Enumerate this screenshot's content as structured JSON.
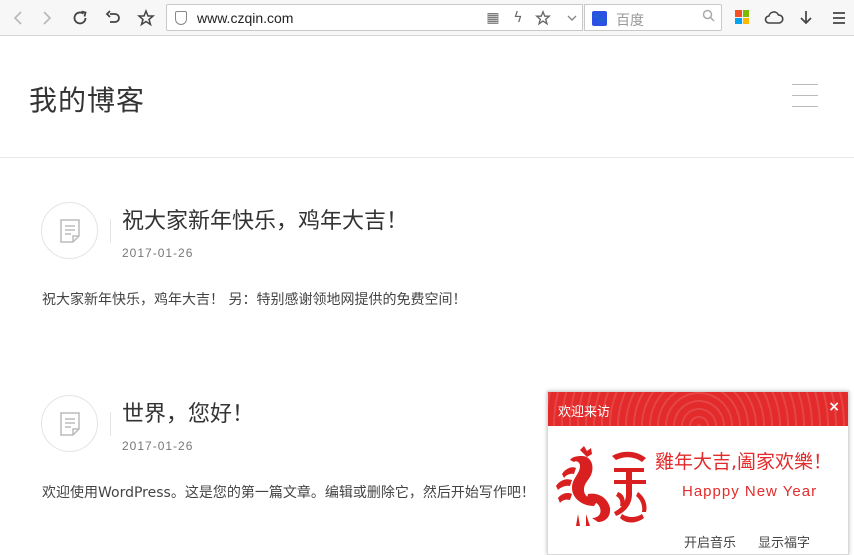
{
  "browser": {
    "url": "www.czqin.com",
    "search_engine": "百度",
    "icons": {
      "back": "back-icon",
      "forward": "forward-icon",
      "reload": "reload-icon",
      "undo": "undo-icon",
      "bookmark": "star-icon",
      "qr": "qr-code-icon",
      "flash": "lightning-icon",
      "url_star": "star-icon",
      "dropdown": "chevron-down-icon",
      "search": "search-icon",
      "apps": "apps-icon",
      "cloud": "cloud-icon",
      "download": "download-icon",
      "menu": "menu-icon"
    }
  },
  "site": {
    "title": "我的博客"
  },
  "posts": [
    {
      "title": "祝大家新年快乐，鸡年大吉！",
      "date": "2017-01-26",
      "excerpt": "祝大家新年快乐，鸡年大吉！ 另：特别感谢领地网提供的免费空间！"
    },
    {
      "title": "世界，您好！",
      "date": "2017-01-26",
      "excerpt": "欢迎使用WordPress。这是您的第一篇文章。编辑或删除它，然后开始写作吧！"
    }
  ],
  "popup": {
    "title": "欢迎来访",
    "close": "×",
    "greeting_cn": "雞年大吉,阖家欢樂！",
    "greeting_en": "Happpy New Year",
    "music_link": "开启音乐",
    "fu_link": "显示福字",
    "accent": "#e32b2b"
  }
}
